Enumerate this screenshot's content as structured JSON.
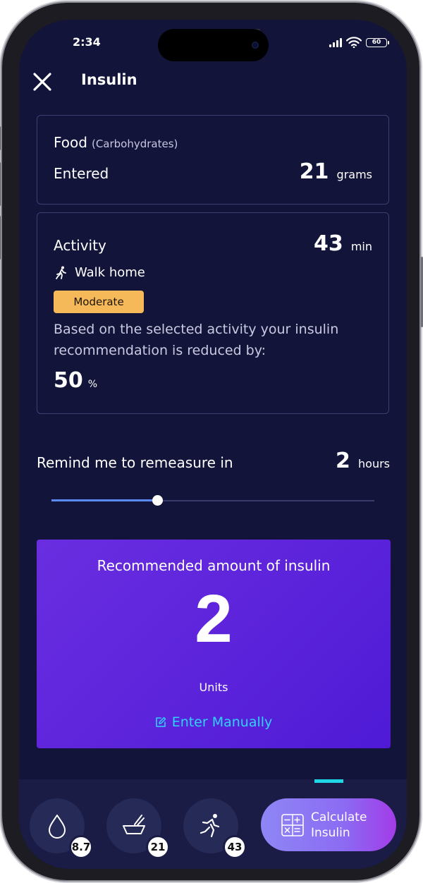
{
  "status_bar": {
    "time": "2:34",
    "battery": "60"
  },
  "header": {
    "title": "Insulin"
  },
  "food": {
    "label": "Food",
    "sublabel": "(Carbohydrates)",
    "entered_label": "Entered",
    "value": "21",
    "unit": "grams"
  },
  "activity": {
    "label": "Activity",
    "value": "43",
    "unit": "min",
    "name": "Walk home",
    "intensity": "Moderate",
    "description": "Based on the selected activity your insulin recommendation is reduced by:",
    "reduction_value": "50",
    "reduction_unit": "%"
  },
  "reminder": {
    "label": "Remind me to remeasure in",
    "value": "2",
    "unit": "hours",
    "slider_fraction": 0.33
  },
  "recommendation": {
    "title": "Recommended amount of insulin",
    "value": "2",
    "unit": "Units",
    "enter_manually": "Enter Manually"
  },
  "bottom_nav": {
    "glucose": {
      "icon": "drop-icon",
      "value": "8.7"
    },
    "food": {
      "icon": "bowl-icon",
      "value": "21"
    },
    "activity": {
      "icon": "runner-icon",
      "value": "43"
    },
    "calculate": {
      "icon": "calculator-icon",
      "label_line1": "Calculate",
      "label_line2": "Insulin"
    }
  },
  "colors": {
    "background": "#13143a",
    "accent_purple": "#5b1fdb",
    "link": "#2fd3ff",
    "badge": "#f5b95a",
    "slider": "#5b8af5",
    "indicator": "#1fd6e6"
  }
}
